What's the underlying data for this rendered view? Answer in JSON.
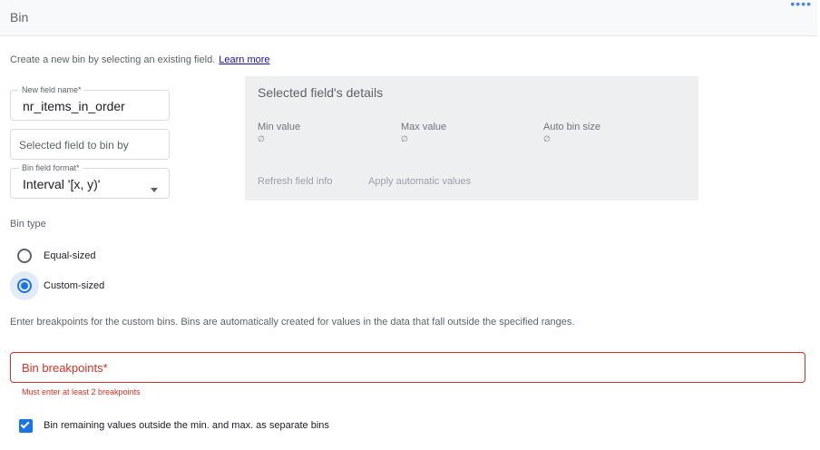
{
  "header": {
    "title": "Bin",
    "more_icon": "more-horiz-icon"
  },
  "intro": {
    "text": "Create a new bin by selecting an existing field.",
    "link": "Learn more"
  },
  "fields": {
    "name": {
      "label": "New field name*",
      "value": "nr_items_in_order"
    },
    "selected_field": {
      "placeholder": "Selected field to bin by"
    },
    "format": {
      "label": "Bin field format*",
      "value": "Interval '[x, y)'",
      "icon": "chevron-down-icon"
    }
  },
  "details": {
    "title": "Selected field's details",
    "min_label": "Min value",
    "min_value": "∅",
    "max_label": "Max value",
    "max_value": "∅",
    "auto_label": "Auto bin size",
    "auto_value": "∅",
    "refresh": "Refresh field info",
    "apply": "Apply automatic values"
  },
  "bin_type": {
    "label": "Bin type",
    "options": [
      {
        "label": "Equal-sized",
        "selected": false
      },
      {
        "label": "Custom-sized",
        "selected": true
      }
    ]
  },
  "hint": "Enter breakpoints for the custom bins. Bins are automatically created for values in the data that fall outside the specified ranges.",
  "breakpoints": {
    "placeholder": "Bin breakpoints*",
    "error": "Must enter at least 2 breakpoints"
  },
  "checkbox": {
    "label": "Bin remaining values outside the min. and max. as separate bins",
    "checked": true
  },
  "colors": {
    "accent": "#1a73e8",
    "error": "#d93025",
    "panel": "#eeeff1"
  }
}
